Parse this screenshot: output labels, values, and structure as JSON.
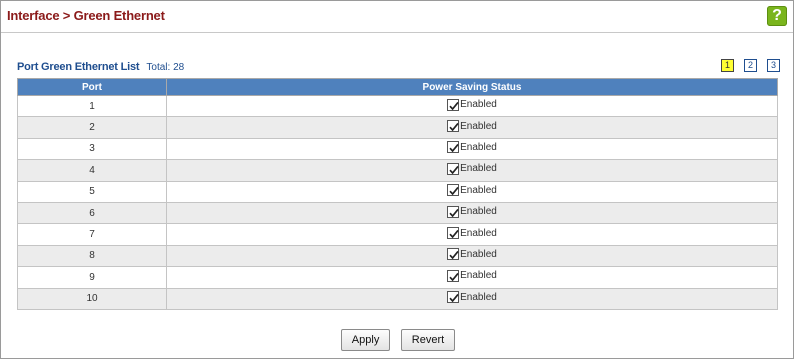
{
  "header": {
    "title": "Interface > Green Ethernet",
    "help_label": "?"
  },
  "list": {
    "title": "Port Green Ethernet List",
    "total": "Total: 28"
  },
  "pager": {
    "pages": [
      "1",
      "2",
      "3"
    ],
    "active": "1"
  },
  "table": {
    "columns": [
      "Port",
      "Power Saving Status"
    ],
    "rows": [
      {
        "port": "1",
        "checked": true,
        "status": "Enabled"
      },
      {
        "port": "2",
        "checked": true,
        "status": "Enabled"
      },
      {
        "port": "3",
        "checked": true,
        "status": "Enabled"
      },
      {
        "port": "4",
        "checked": true,
        "status": "Enabled"
      },
      {
        "port": "5",
        "checked": true,
        "status": "Enabled"
      },
      {
        "port": "6",
        "checked": true,
        "status": "Enabled"
      },
      {
        "port": "7",
        "checked": true,
        "status": "Enabled"
      },
      {
        "port": "8",
        "checked": true,
        "status": "Enabled"
      },
      {
        "port": "9",
        "checked": true,
        "status": "Enabled"
      },
      {
        "port": "10",
        "checked": true,
        "status": "Enabled"
      }
    ]
  },
  "actions": {
    "apply_label": "Apply",
    "revert_label": "Revert"
  },
  "colors": {
    "title": "#8b1a1a",
    "accent": "#1f4e8f",
    "table_header": "#4f81bd",
    "help_icon": "#7ab51d",
    "active_page": "#ffff33"
  }
}
